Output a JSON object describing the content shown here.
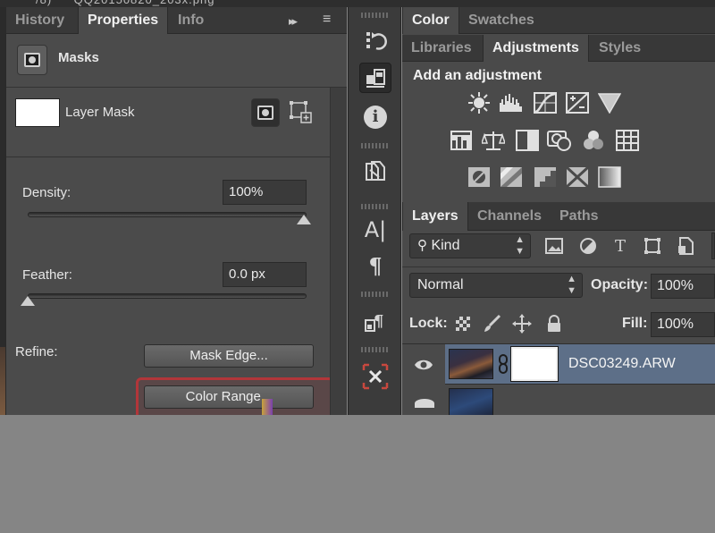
{
  "properties_panel": {
    "tabs": [
      {
        "label": "History"
      },
      {
        "label": "Properties"
      },
      {
        "label": "Info"
      }
    ],
    "collapse_glyph": "▸▸",
    "menu_glyph": "≡",
    "section_title": "Masks",
    "mask_type_label": "Layer Mask",
    "density_label": "Density:",
    "density_value": "100%",
    "density_level": 1.0,
    "feather_label": "Feather:",
    "feather_value": "0.0 px",
    "feather_level": 0.0,
    "refine_label": "Refine:",
    "mask_edge_button": "Mask Edge...",
    "color_range_button": "Color Range..."
  },
  "toolstrip": {
    "tools": [
      {
        "icon": "history-brush-icon"
      },
      {
        "icon": "properties-icon",
        "active": true
      },
      {
        "icon": "info-icon",
        "glyph": "i"
      },
      {
        "icon": "clone-source-icon"
      },
      {
        "icon": "character-icon",
        "glyph": "A|"
      },
      {
        "icon": "paragraph-icon",
        "glyph": "¶"
      },
      {
        "icon": "paragraph-styles-icon",
        "glyph": "¶"
      },
      {
        "icon": "tool-presets-icon"
      }
    ]
  },
  "right_panel": {
    "top_tabs": [
      {
        "label": "Color"
      },
      {
        "label": "Swatches"
      }
    ],
    "second_tabs": [
      {
        "label": "Libraries"
      },
      {
        "label": "Adjustments"
      },
      {
        "label": "Styles"
      }
    ],
    "adjustments_title": "Add an adjustment",
    "adjustment_icons_row1": [
      "brightness-contrast-icon",
      "levels-icon",
      "curves-icon",
      "exposure-icon",
      "vibrance-icon"
    ],
    "adjustment_icons_row2": [
      "hue-saturation-icon",
      "color-balance-icon",
      "black-white-icon",
      "photo-filter-icon",
      "channel-mixer-icon",
      "color-lookup-icon"
    ],
    "adjustment_icons_row3": [
      "invert-icon",
      "posterize-icon",
      "threshold-icon",
      "selective-color-icon",
      "gradient-map-icon"
    ],
    "layer_tabs": [
      {
        "label": "Layers"
      },
      {
        "label": "Channels"
      },
      {
        "label": "Paths"
      }
    ],
    "filter_kind": "Kind",
    "blend_mode": "Normal",
    "opacity_label": "Opacity:",
    "opacity_value": "100%",
    "lock_label": "Lock:",
    "fill_label": "Fill:",
    "fill_value": "100%",
    "layers": [
      {
        "name": "DSC03249.ARW",
        "selected": true
      }
    ]
  },
  "colors": {
    "panel_bg": "#4b4b4b",
    "selected_layer": "#5d6f88",
    "highlight": "#b2363a",
    "bottom_area": "#858585"
  }
}
